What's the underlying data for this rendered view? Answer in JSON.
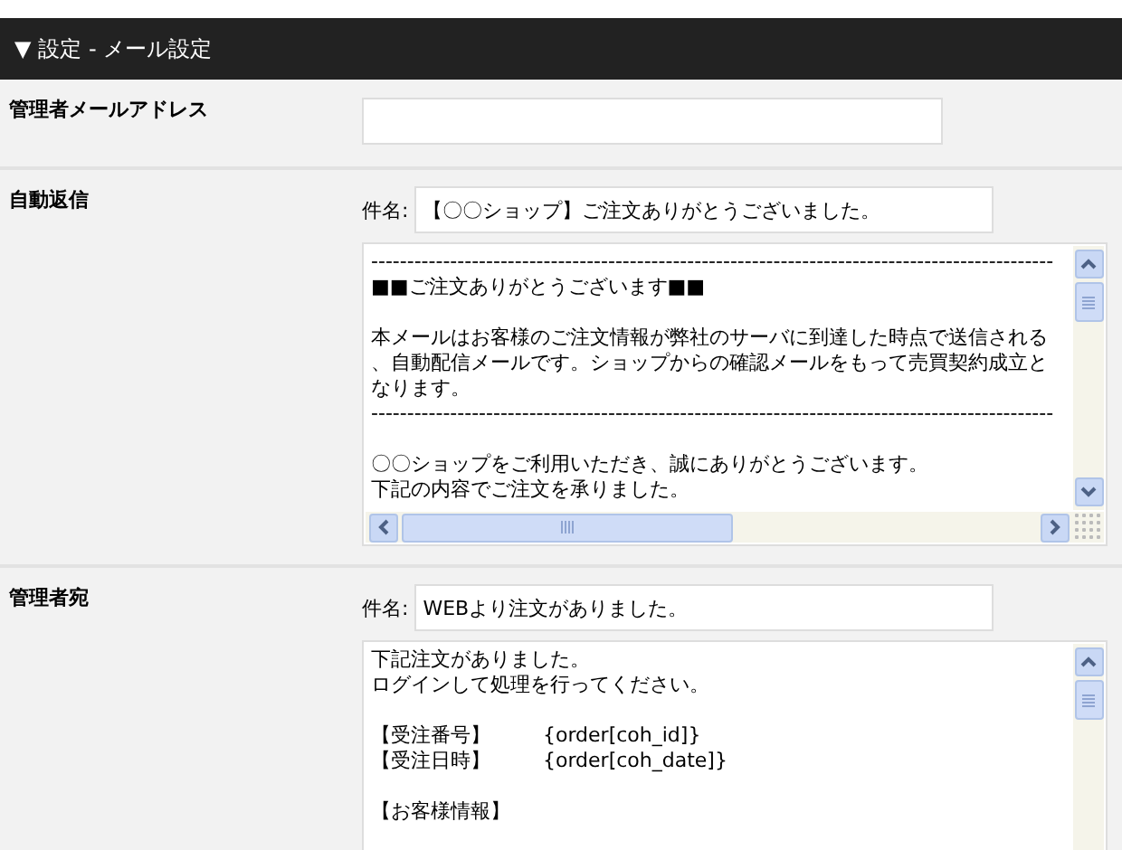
{
  "header": {
    "marker": "▼",
    "title": "設定 - メール設定"
  },
  "sections": [
    {
      "kind": "address",
      "label": "管理者メールアドレス"
    },
    {
      "kind": "mail",
      "label": "自動返信",
      "subject_label": "件名:",
      "subject": "【〇〇ショップ】ご注文ありがとうございました。",
      "horizontal_scroll": true,
      "body": [
        [
          "-----------------------------------------------------------------------------------------------",
          "■■ご注文ありがとうございます■■"
        ],
        [
          "本メールはお客様のご注文情報が弊社のサーバに到達した時点で送信される",
          "、自動配信メールです。ショップからの確認メールをもって売買契約成立と",
          "なります。",
          "-----------------------------------------------------------------------------------------------"
        ],
        [
          "〇〇ショップをご利用いただき、誠にありがとうございます。",
          "下記の内容でご注文を承りました。"
        ]
      ]
    },
    {
      "kind": "mail",
      "label": "管理者宛",
      "subject_label": "件名:",
      "subject": "WEBより注文がありました。",
      "horizontal_scroll": false,
      "body": [
        [
          "下記注文がありました。",
          "ログインして処理を行ってください。"
        ],
        [
          "【受注番号】\t{order[coh_id]}",
          "【受注日時】\t{order[coh_date]}"
        ],
        [
          "【お客様情報】"
        ]
      ]
    }
  ]
}
